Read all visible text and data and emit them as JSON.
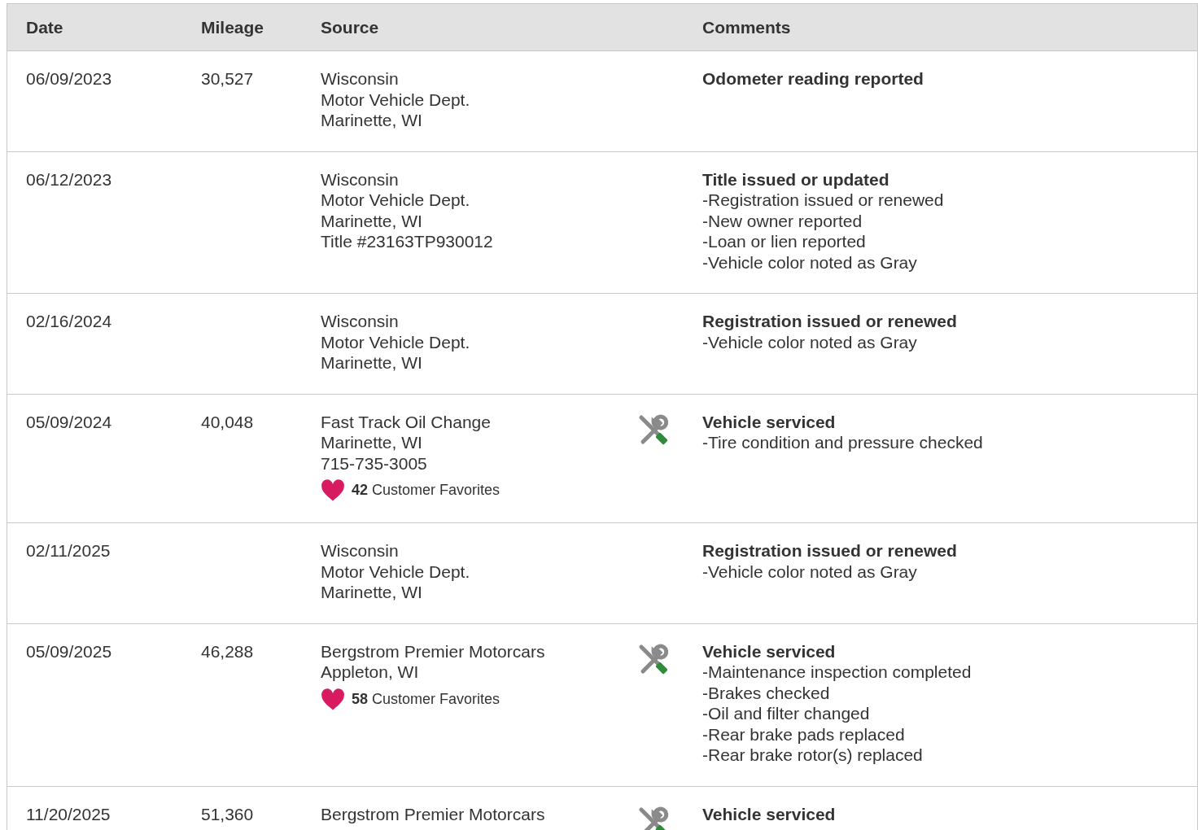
{
  "table": {
    "columns": [
      "Date",
      "Mileage",
      "Source",
      "Comments"
    ],
    "rows": [
      {
        "date": "06/09/2023",
        "mileage": "30,527",
        "source": [
          "Wisconsin",
          "Motor Vehicle Dept.",
          "Marinette, WI"
        ],
        "service_icon": false,
        "comment_title": "Odometer reading reported",
        "comment_items": []
      },
      {
        "date": "06/12/2023",
        "source": [
          "Wisconsin",
          "Motor Vehicle Dept.",
          "Marinette, WI",
          "Title #23163TP930012"
        ],
        "service_icon": false,
        "comment_title": "Title issued or updated",
        "comment_items": [
          "-Registration issued or renewed",
          "-New owner reported",
          "-Loan or lien reported",
          "-Vehicle color noted as Gray"
        ]
      },
      {
        "date": "02/16/2024",
        "source": [
          "Wisconsin",
          "Motor Vehicle Dept.",
          "Marinette, WI"
        ],
        "service_icon": false,
        "comment_title": "Registration issued or renewed",
        "comment_items": [
          "-Vehicle color noted as Gray"
        ]
      },
      {
        "date": "05/09/2024",
        "mileage": "40,048",
        "source": [
          "Fast Track Oil Change",
          "Marinette, WI",
          "715-735-3005"
        ],
        "favorites": "**42** Customer Favorites",
        "service_icon": true,
        "comment_title": "Vehicle serviced",
        "comment_items": [
          "-Tire condition and pressure checked"
        ]
      },
      {
        "date": "02/11/2025",
        "source": [
          "Wisconsin",
          "Motor Vehicle Dept.",
          "Marinette, WI"
        ],
        "service_icon": false,
        "comment_title": "Registration issued or renewed",
        "comment_items": [
          "-Vehicle color noted as Gray"
        ]
      },
      {
        "date": "05/09/2025",
        "mileage": "46,288",
        "source": [
          "Bergstrom Premier Motorcars",
          "Appleton, WI"
        ],
        "favorites": "**58** Customer Favorites",
        "service_icon": true,
        "comment_title": "Vehicle serviced",
        "comment_items": [
          "-Maintenance inspection completed",
          "-Brakes checked",
          "-Oil and filter changed",
          "-Rear brake pads replaced",
          "-Rear brake rotor(s) replaced"
        ]
      },
      {
        "date": "11/20/2025",
        "mileage": "51,360",
        "source": [
          "Bergstrom Premier Motorcars"
        ],
        "service_icon": true,
        "comment_title": "Vehicle serviced",
        "comment_items": []
      }
    ]
  }
}
